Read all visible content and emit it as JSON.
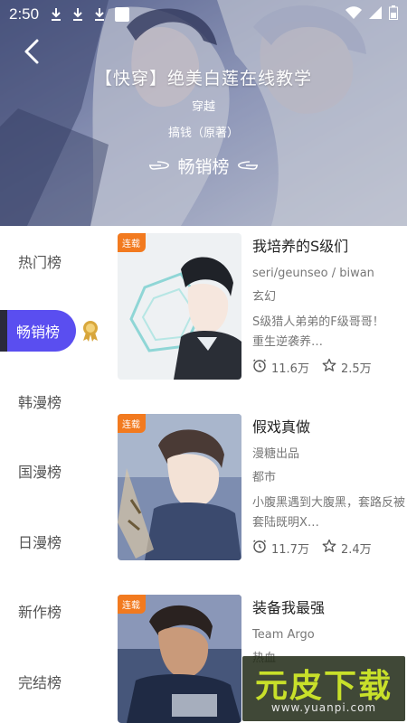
{
  "status_bar": {
    "time": "2:50"
  },
  "banner": {
    "title": "【快穿】绝美白莲在线教学",
    "genre": "穿越",
    "author": "搞钱（原著）",
    "rank_label": "畅销榜"
  },
  "sidebar": {
    "items": [
      {
        "label": "热门榜",
        "active": false
      },
      {
        "label": "畅销榜",
        "active": true
      },
      {
        "label": "韩漫榜",
        "active": false
      },
      {
        "label": "国漫榜",
        "active": false
      },
      {
        "label": "日漫榜",
        "active": false
      },
      {
        "label": "新作榜",
        "active": false
      },
      {
        "label": "完结榜",
        "active": false
      }
    ]
  },
  "books": [
    {
      "tag": "连载",
      "title": "我培养的S级们",
      "author": "seri/geunseo / biwan",
      "genre": "玄幻",
      "desc": "S级猎人弟弟的F级哥哥！　　重生逆袭养…",
      "views": "11.6万",
      "favorites": "2.5万"
    },
    {
      "tag": "连载",
      "title": "假戏真做",
      "author": "漫糖出品",
      "genre": "都市",
      "desc": "小腹黑遇到大腹黑，套路反被套陆既明X…",
      "views": "11.7万",
      "favorites": "2.4万"
    },
    {
      "tag": "连载",
      "title": "装备我最强",
      "author": "Team Argo",
      "genre": "热血",
      "desc": "",
      "views": "",
      "favorites": ""
    }
  ],
  "watermark": {
    "main": "元皮下载",
    "sub": "www.yuanpi.com"
  }
}
